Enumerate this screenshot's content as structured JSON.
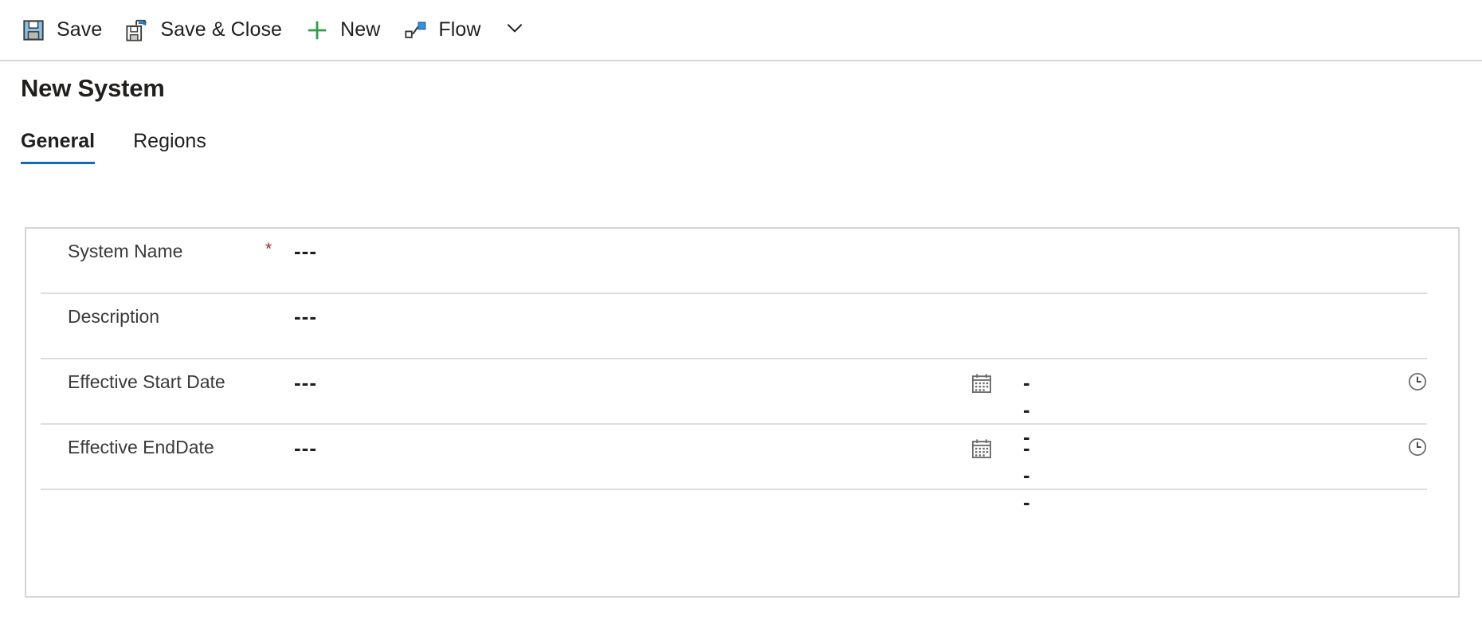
{
  "commandbar": {
    "buttons": [
      {
        "label": "Save",
        "icon": "save-icon"
      },
      {
        "label": "Save & Close",
        "icon": "save-and-close-icon"
      },
      {
        "label": "New",
        "icon": "plus-icon"
      },
      {
        "label": "Flow",
        "icon": "flow-icon"
      }
    ],
    "overflow_icon": "chevron-down-icon"
  },
  "page": {
    "title": "New System"
  },
  "tabs": [
    {
      "label": "General",
      "active": true
    },
    {
      "label": "Regions",
      "active": false
    }
  ],
  "form": {
    "rows": [
      {
        "label": "System Name",
        "required": true,
        "required_marker": "*",
        "value": "---"
      },
      {
        "label": "Description",
        "required": false,
        "required_marker": "",
        "value": "---"
      },
      {
        "label": "Effective Start Date",
        "required": false,
        "required_marker": "",
        "value": "---",
        "time_value": "---",
        "date_icon": "calendar-icon",
        "time_icon": "clock-icon"
      },
      {
        "label": "Effective EndDate",
        "required": false,
        "required_marker": "",
        "value": "---",
        "time_value": "---",
        "date_icon": "calendar-icon",
        "time_icon": "clock-icon"
      }
    ]
  },
  "colors": {
    "accent": "#0f6cbd",
    "required": "#a4262c",
    "new_icon": "#2ca04a",
    "save_icon": "#89c1ec",
    "border": "#d6d6d6",
    "divider": "#dededc",
    "text": "#201f1e"
  }
}
